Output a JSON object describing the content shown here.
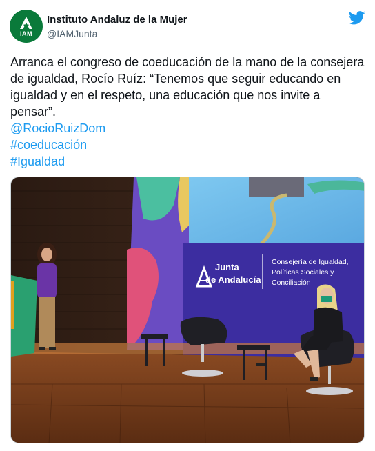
{
  "tweet": {
    "author_name": "Instituto Andaluz de la Mujer",
    "author_handle": "@IAMJunta",
    "avatar_abbr": "IAM",
    "text": "Arranca el congreso de coeducación de la mano de la consejera de igualdad, Rocío Ruíz: “Tenemos que seguir educando en igualdad y en el respeto, una educación que nos invite a pensar”.",
    "links": [
      "@RocioRuizDom",
      "#coeducación",
      "#Igualdad"
    ],
    "platform_icon": "twitter-bird-icon",
    "colors": {
      "link": "#1d9bf0",
      "avatar_bg": "#0a7a3a",
      "brand": "#1d9bf0"
    }
  },
  "photo": {
    "banner_org": [
      "Junta",
      "de Andalucía"
    ],
    "banner_dept": [
      "Consejería de Igualdad,",
      "Políticas Sociales y",
      "Conciliación"
    ]
  }
}
